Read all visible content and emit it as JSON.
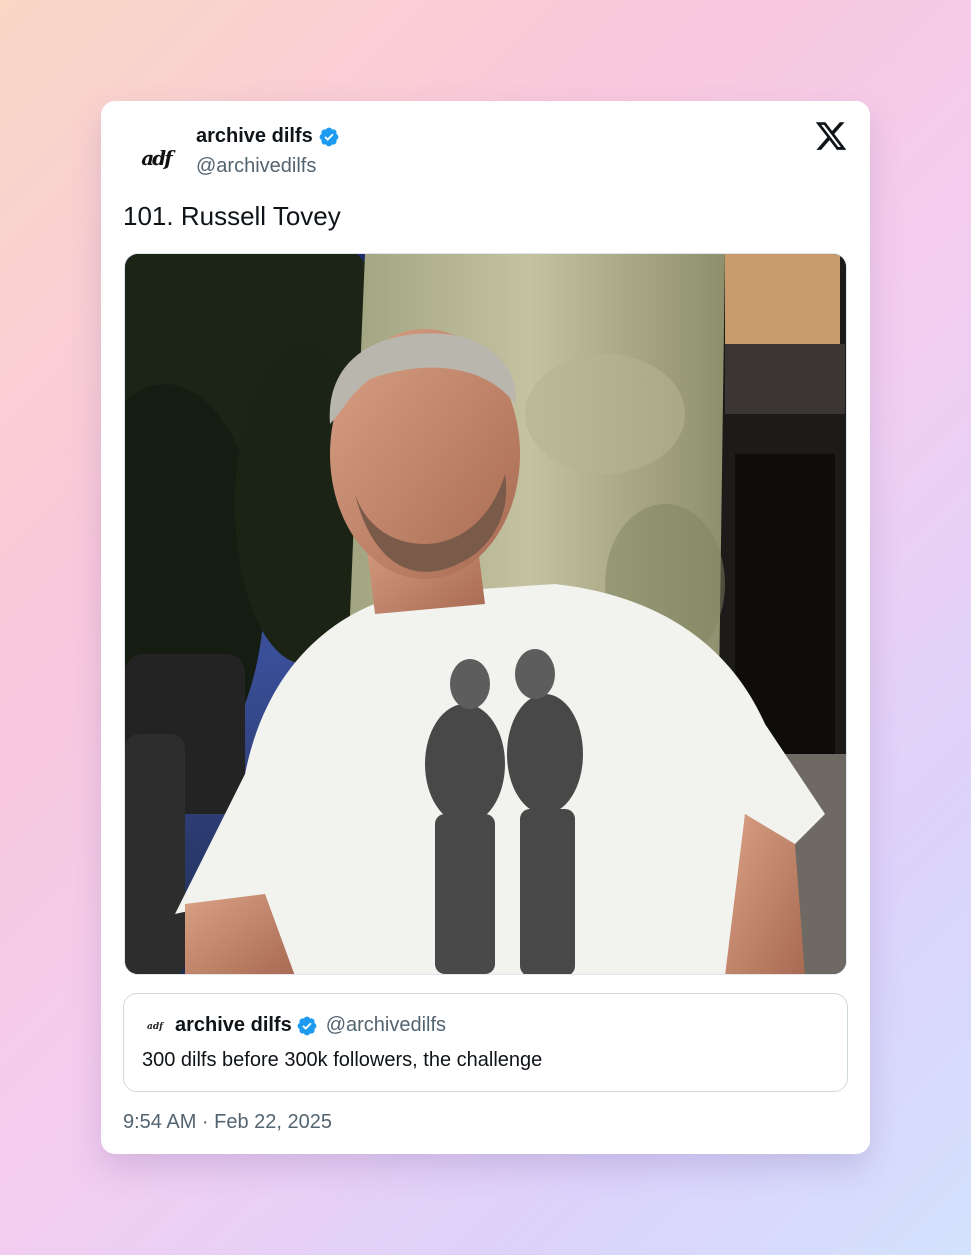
{
  "author": {
    "display_name": "archive dilfs",
    "handle": "@archivedilfs",
    "avatar_text": "adf"
  },
  "tweet": {
    "text": "101. Russell Tovey",
    "timestamp": "9:54 AM · Feb 22, 2025"
  },
  "quote": {
    "display_name": "archive dilfs",
    "handle": "@archivedilfs",
    "text": "300 dilfs before 300k followers, the challenge"
  },
  "icons": {
    "verified": "verified-badge-icon",
    "platform": "x-logo-icon"
  },
  "colors": {
    "verified": "#1d9bf0",
    "text_primary": "#0f1419",
    "text_secondary": "#536471"
  }
}
